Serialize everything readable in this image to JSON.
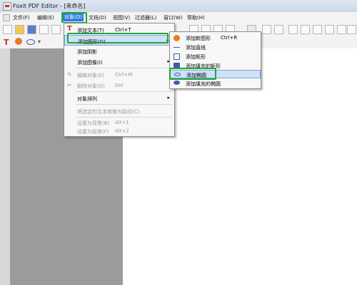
{
  "window": {
    "title": "Foxit PDF Editor - [未命名]"
  },
  "menubar": {
    "items": [
      "文件(F)",
      "编辑(E)",
      "对象(O)",
      "文档(D)",
      "视图(V)",
      "过滤器(L)",
      "窗口(W)",
      "帮助(H)"
    ],
    "active_index": 2
  },
  "object_menu": {
    "items": [
      {
        "label": "添加文本(T)",
        "shortcut": "Ctrl+T"
      },
      {
        "label": "添加图形(G)"
      },
      {
        "label": "添加阴影"
      },
      {
        "label": "添加图像(I)"
      },
      {
        "label": "编辑对象(E)",
        "shortcut": "Ctrl+M"
      },
      {
        "label": "删除对象(D)",
        "shortcut": "Del"
      },
      {
        "label": "对象排列"
      },
      {
        "label": "将选定的文本转换为路径(C)"
      },
      {
        "label": "设置为背景(B)",
        "shortcut": "Alt+1"
      },
      {
        "label": "设置为前景(F)",
        "shortcut": "Alt+2"
      }
    ]
  },
  "shape_submenu": {
    "items": [
      {
        "label": "添加新图形",
        "shortcut": "Ctrl+R"
      },
      {
        "label": "添加直线"
      },
      {
        "label": "添加矩形"
      },
      {
        "label": "添加填充的矩形"
      },
      {
        "label": "添加椭圆"
      },
      {
        "label": "添加填充的椭圆"
      }
    ]
  },
  "colors": {
    "accent": "#2b7de1",
    "highlight_box": "#1fa63a",
    "workspace": "#9b9b9b"
  }
}
